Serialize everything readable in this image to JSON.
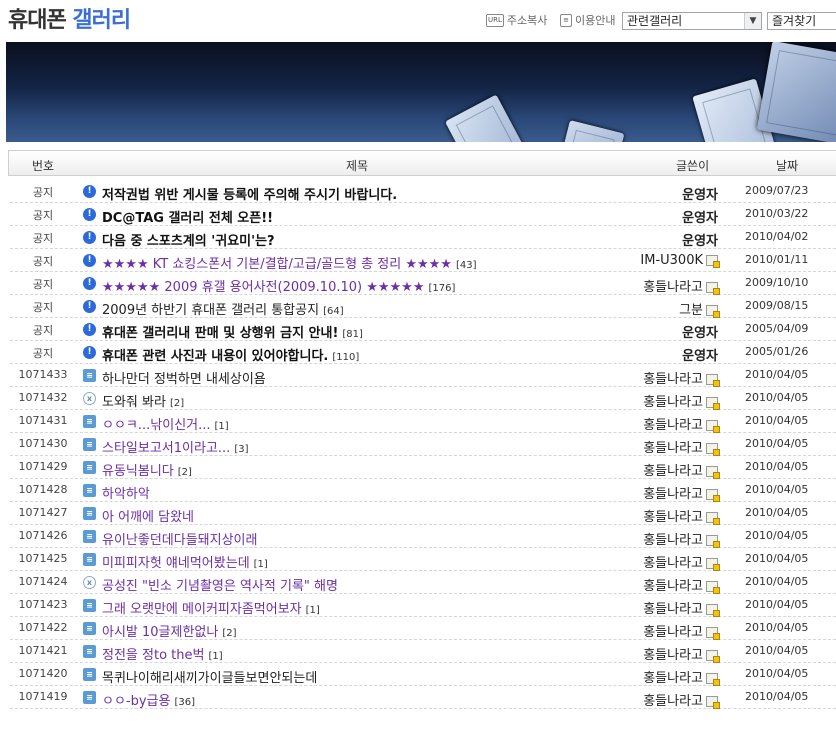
{
  "header": {
    "title_part1": "휴대폰",
    "title_part2": "갤러리",
    "url_icon": "URL",
    "url_copy": "주소복사",
    "guide": "이용안내",
    "related_select": "관련갤러리",
    "favorites_select": "즐겨찾기"
  },
  "columns": {
    "num": "번호",
    "subject": "제목",
    "author": "글쓴이",
    "date": "날짜"
  },
  "rows": [
    {
      "num": "공지",
      "icon": "notice",
      "subject": "저작권법 위반 게시물 등록에 주의해 주시기 바랍니다.",
      "style": "bold",
      "comments": "",
      "author": "운영자",
      "author_bold": true,
      "user_icon": false,
      "date": "2009/07/23"
    },
    {
      "num": "공지",
      "icon": "notice",
      "subject": "DC@TAG 갤러리 전체 오픈!!",
      "style": "bold",
      "comments": "",
      "author": "운영자",
      "author_bold": true,
      "user_icon": false,
      "date": "2010/03/22"
    },
    {
      "num": "공지",
      "icon": "notice",
      "subject": "다음 중 스포츠계의 '귀요미'는?",
      "style": "bold",
      "comments": "",
      "author": "운영자",
      "author_bold": true,
      "user_icon": false,
      "date": "2010/04/02"
    },
    {
      "num": "공지",
      "icon": "notice",
      "subject": "★★★★ KT 쇼킹스폰서 기본/결합/고급/골드형 총 정리 ★★★★",
      "style": "purple",
      "comments": "[43]",
      "author": "IM-U300K",
      "author_bold": false,
      "user_icon": true,
      "date": "2010/01/11"
    },
    {
      "num": "공지",
      "icon": "notice",
      "subject": "★★★★★ 2009 휴갤 용어사전(2009.10.10) ★★★★★",
      "style": "purple",
      "comments": "[176]",
      "author": "홍들나라고",
      "author_bold": false,
      "user_icon": true,
      "date": "2009/10/10"
    },
    {
      "num": "공지",
      "icon": "notice",
      "subject": "2009년 하반기 휴대폰 갤러리 통합공지",
      "style": "plain",
      "comments": "[64]",
      "author": "그분",
      "author_bold": false,
      "user_icon": true,
      "date": "2009/08/15"
    },
    {
      "num": "공지",
      "icon": "notice",
      "subject": "휴대폰 갤러리내 판매 및 상행위 금지 안내!",
      "style": "bold",
      "comments": "[81]",
      "author": "운영자",
      "author_bold": true,
      "user_icon": false,
      "date": "2005/04/09"
    },
    {
      "num": "공지",
      "icon": "notice",
      "subject": "휴대폰 관련 사진과 내용이 있어야합니다.",
      "style": "bold",
      "comments": "[110]",
      "author": "운영자",
      "author_bold": true,
      "user_icon": false,
      "date": "2005/01/26"
    },
    {
      "num": "1071433",
      "icon": "post",
      "subject": "하나만더 정벅하면 내세상이욤",
      "style": "plain",
      "comments": "",
      "author": "홍들나라고",
      "author_bold": false,
      "user_icon": true,
      "date": "2010/04/05"
    },
    {
      "num": "1071432",
      "icon": "img",
      "subject": "도와줘 봐라",
      "style": "plain",
      "comments": "[2]",
      "author": "홍들나라고",
      "author_bold": false,
      "user_icon": true,
      "date": "2010/04/05"
    },
    {
      "num": "1071431",
      "icon": "post",
      "subject": "ㅇㅇㅋ...낚이신거...",
      "style": "purple",
      "comments": "[1]",
      "author": "홍들나라고",
      "author_bold": false,
      "user_icon": true,
      "date": "2010/04/05"
    },
    {
      "num": "1071430",
      "icon": "post",
      "subject": "스타일보고서1이라고...",
      "style": "purple",
      "comments": "[3]",
      "author": "홍들나라고",
      "author_bold": false,
      "user_icon": true,
      "date": "2010/04/05"
    },
    {
      "num": "1071429",
      "icon": "post",
      "subject": "유동닉봄니다",
      "style": "purple",
      "comments": "[2]",
      "author": "홍들나라고",
      "author_bold": false,
      "user_icon": true,
      "date": "2010/04/05"
    },
    {
      "num": "1071428",
      "icon": "post",
      "subject": "하악하악",
      "style": "purple",
      "comments": "",
      "author": "홍들나라고",
      "author_bold": false,
      "user_icon": true,
      "date": "2010/04/05"
    },
    {
      "num": "1071427",
      "icon": "post",
      "subject": "아 어깨에 담왔네",
      "style": "purple",
      "comments": "",
      "author": "홍들나라고",
      "author_bold": false,
      "user_icon": true,
      "date": "2010/04/05"
    },
    {
      "num": "1071426",
      "icon": "post",
      "subject": "유이난좋던데다들돼지상이래",
      "style": "purple",
      "comments": "",
      "author": "홍들나라고",
      "author_bold": false,
      "user_icon": true,
      "date": "2010/04/05"
    },
    {
      "num": "1071425",
      "icon": "post",
      "subject": "미피피자헛 얘네먹어봤는데",
      "style": "purple",
      "comments": "[1]",
      "author": "홍들나라고",
      "author_bold": false,
      "user_icon": true,
      "date": "2010/04/05"
    },
    {
      "num": "1071424",
      "icon": "img",
      "subject": "공성진 \"빈소 기념촬영은 역사적 기록\" 해명",
      "style": "purple",
      "comments": "",
      "author": "홍들나라고",
      "author_bold": false,
      "user_icon": true,
      "date": "2010/04/05"
    },
    {
      "num": "1071423",
      "icon": "post",
      "subject": "그래 오랫만에 메이커피자좀먹어보자",
      "style": "purple",
      "comments": "[1]",
      "author": "홍들나라고",
      "author_bold": false,
      "user_icon": true,
      "date": "2010/04/05"
    },
    {
      "num": "1071422",
      "icon": "post",
      "subject": "아시발 10글제한없나",
      "style": "purple",
      "comments": "[2]",
      "author": "홍들나라고",
      "author_bold": false,
      "user_icon": true,
      "date": "2010/04/05"
    },
    {
      "num": "1071421",
      "icon": "post",
      "subject": "정전을 정to the벅",
      "style": "purple",
      "comments": "[1]",
      "author": "홍들나라고",
      "author_bold": false,
      "user_icon": true,
      "date": "2010/04/05"
    },
    {
      "num": "1071420",
      "icon": "post",
      "subject": "목퀴나이해리새끼가이글들보면안되는데",
      "style": "plain",
      "comments": "",
      "author": "홍들나라고",
      "author_bold": false,
      "user_icon": true,
      "date": "2010/04/05"
    },
    {
      "num": "1071419",
      "icon": "post",
      "subject": "ㅇㅇ-by급용",
      "style": "purple",
      "comments": "[36]",
      "author": "홍들나라고",
      "author_bold": false,
      "user_icon": true,
      "date": "2010/04/05"
    }
  ]
}
